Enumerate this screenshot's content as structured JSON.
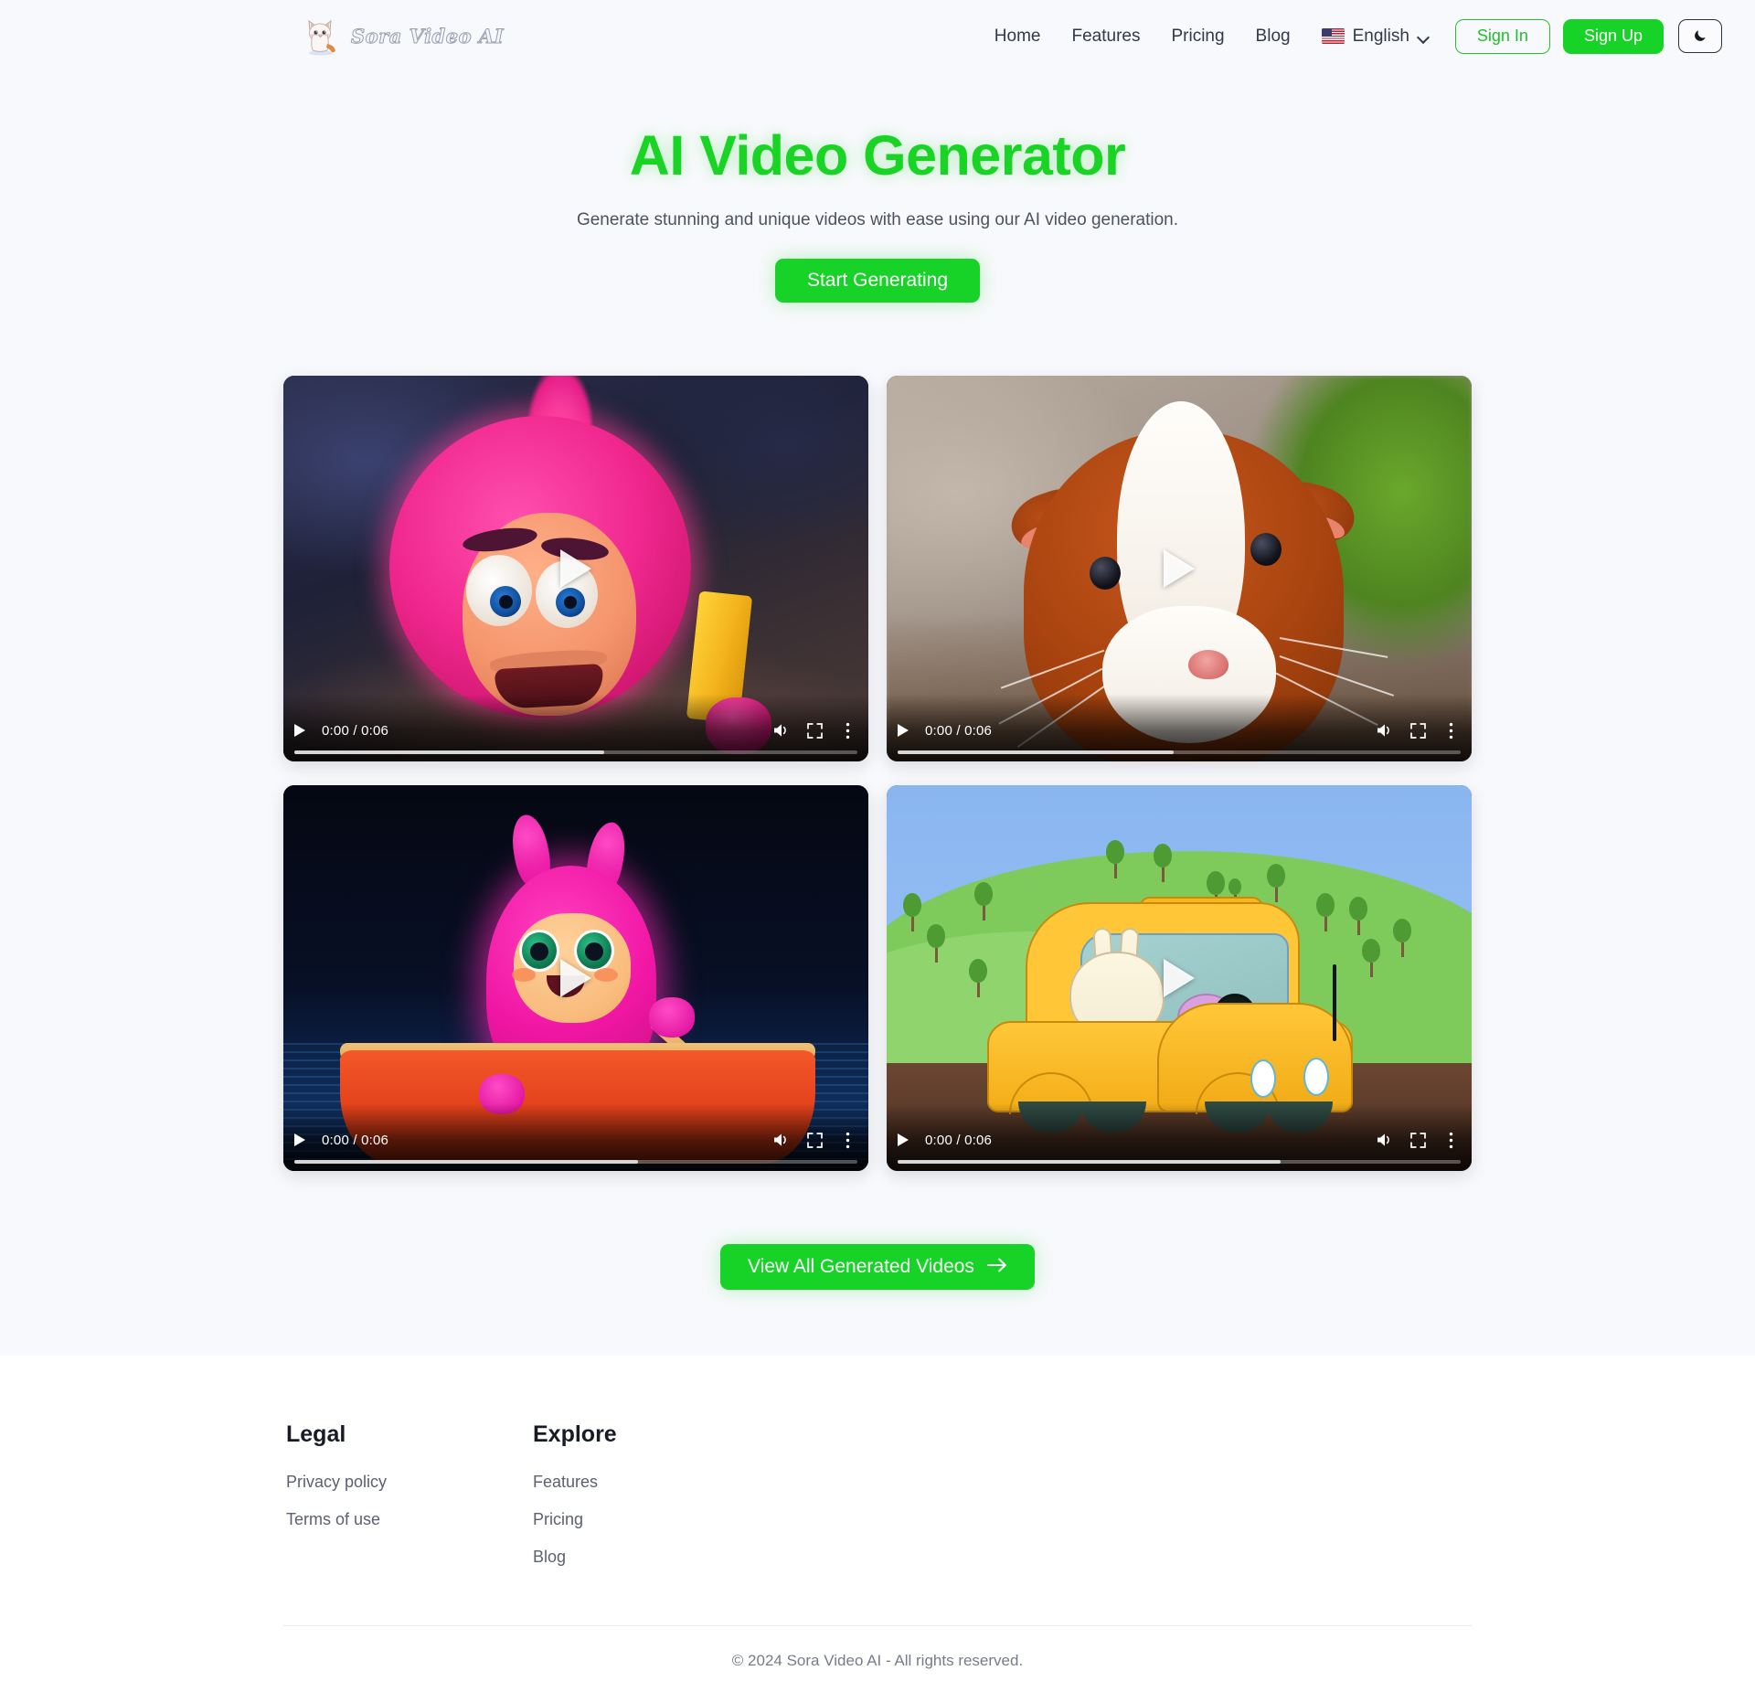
{
  "header": {
    "brand_name": "Sora Video AI",
    "brand_icon": "cat-logo-icon",
    "nav": [
      {
        "label": "Home"
      },
      {
        "label": "Features"
      },
      {
        "label": "Pricing"
      },
      {
        "label": "Blog"
      }
    ],
    "language": {
      "label": "English",
      "flag": "us-flag-icon",
      "chevron": "chevron-down-icon"
    },
    "sign_in_label": "Sign In",
    "sign_up_label": "Sign Up",
    "theme_toggle_icon": "moon-icon"
  },
  "hero": {
    "title": "AI Video Generator",
    "subtitle": "Generate stunning and unique videos with ease using our AI video generation.",
    "cta_label": "Start Generating"
  },
  "videos": [
    {
      "name": "pink-fluffy-monster-with-cheese",
      "time_display": "0:00 / 0:06",
      "current_time": "0:00",
      "duration": "0:06",
      "progress_percent": 55,
      "controls": {
        "play": "play-icon",
        "volume": "volume-icon",
        "fullscreen": "fullscreen-icon",
        "more": "more-options-icon"
      }
    },
    {
      "name": "guinea-pig-closeup",
      "time_display": "0:00 / 0:06",
      "current_time": "0:00",
      "duration": "0:06",
      "progress_percent": 49,
      "controls": {
        "play": "play-icon",
        "volume": "volume-icon",
        "fullscreen": "fullscreen-icon",
        "more": "more-options-icon"
      }
    },
    {
      "name": "pink-monster-rowing-boat",
      "time_display": "0:00 / 0:06",
      "current_time": "0:00",
      "duration": "0:06",
      "progress_percent": 61,
      "controls": {
        "play": "play-icon",
        "volume": "volume-icon",
        "fullscreen": "fullscreen-icon",
        "more": "more-options-icon"
      }
    },
    {
      "name": "cartoon-bunny-driving-yellow-car",
      "time_display": "0:00 / 0:06",
      "current_time": "0:00",
      "duration": "0:06",
      "progress_percent": 68,
      "controls": {
        "play": "play-icon",
        "volume": "volume-icon",
        "fullscreen": "fullscreen-icon",
        "more": "more-options-icon"
      }
    }
  ],
  "view_all": {
    "label": "View All Generated Videos",
    "arrow_icon": "arrow-right-icon"
  },
  "footer": {
    "columns": [
      {
        "heading": "Legal",
        "links": [
          {
            "label": "Privacy policy"
          },
          {
            "label": "Terms of use"
          }
        ]
      },
      {
        "heading": "Explore",
        "links": [
          {
            "label": "Features"
          },
          {
            "label": "Pricing"
          },
          {
            "label": "Blog"
          }
        ]
      }
    ],
    "copyright": "© 2024 Sora Video AI - All rights reserved."
  },
  "colors": {
    "accent_green": "#18d327",
    "hero_green": "#19d424",
    "page_background": "#f8f9fc",
    "footer_background": "#ffffff",
    "text_primary": "#1f2430",
    "text_muted": "#5c6070"
  }
}
